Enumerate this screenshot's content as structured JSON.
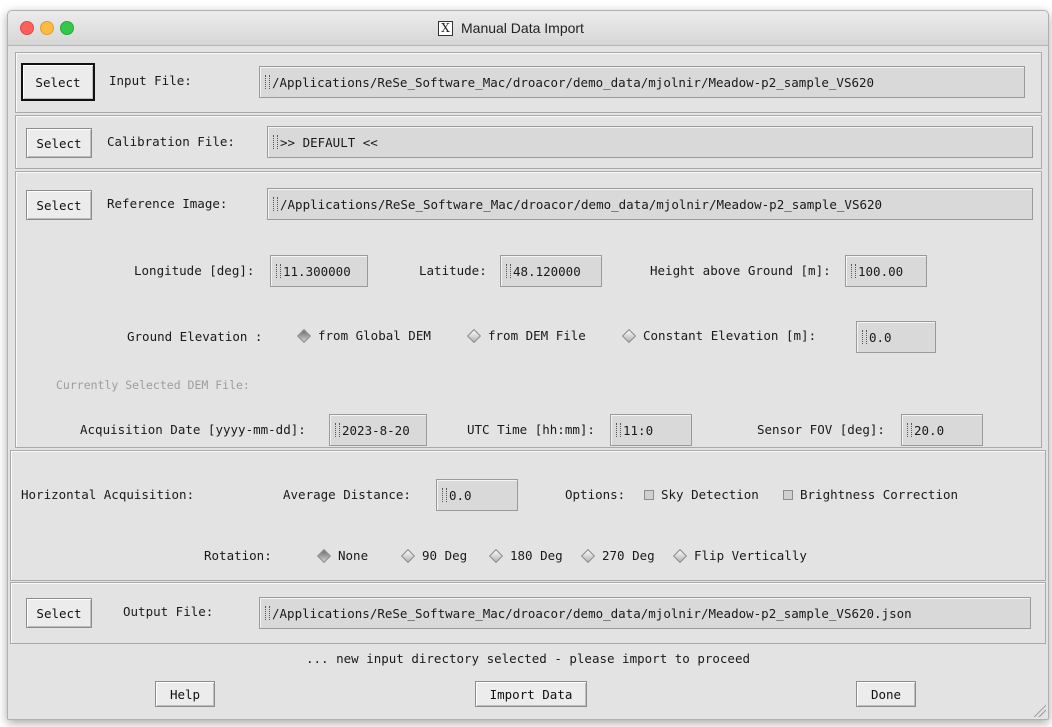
{
  "window": {
    "title": "Manual Data Import"
  },
  "files": {
    "select_label": "Select",
    "input": {
      "label": "Input File:",
      "value": "/Applications/ReSe_Software_Mac/droacor/demo_data/mjolnir/Meadow-p2_sample_VS620"
    },
    "calibration": {
      "label": "Calibration File:",
      "value": ">> DEFAULT <<"
    },
    "reference": {
      "label": "Reference Image:",
      "value": "/Applications/ReSe_Software_Mac/droacor/demo_data/mjolnir/Meadow-p2_sample_VS620"
    }
  },
  "position": {
    "longitude": {
      "label": "Longitude [deg]:",
      "value": "11.300000"
    },
    "latitude": {
      "label": "Latitude:",
      "value": "48.120000"
    },
    "height": {
      "label": "Height above Ground [m]:",
      "value": "100.00"
    }
  },
  "elevation": {
    "label": "Ground Elevation :",
    "options": [
      "from Global DEM",
      "from DEM File",
      "Constant Elevation [m]:"
    ],
    "selected": "from Global DEM",
    "constant_value": "0.0",
    "dem_file_label": "Currently Selected DEM File:"
  },
  "acquisition": {
    "date": {
      "label": "Acquisition Date [yyyy-mm-dd]:",
      "value": "2023-8-20"
    },
    "time": {
      "label": "UTC Time [hh:mm]:",
      "value": "11:0"
    },
    "fov": {
      "label": "Sensor FOV [deg]:",
      "value": "20.0"
    }
  },
  "horizontal": {
    "label": "Horizontal Acquisition:",
    "distance": {
      "label": "Average Distance:",
      "value": "0.0"
    },
    "options_label": "Options:",
    "options": [
      "Sky Detection",
      "Brightness Correction"
    ],
    "rotation_label": "Rotation:",
    "rotation_options": [
      "None",
      "90 Deg",
      "180 Deg",
      "270 Deg",
      "Flip Vertically"
    ],
    "rotation_selected": "None"
  },
  "output": {
    "label": "Output File:",
    "value": "/Applications/ReSe_Software_Mac/droacor/demo_data/mjolnir/Meadow-p2_sample_VS620.json"
  },
  "status": "... new input directory selected - please import to proceed",
  "buttons": {
    "help": "Help",
    "import": "Import Data",
    "done": "Done"
  },
  "colors": {
    "close": "#fc605c",
    "minimize": "#fdbc40",
    "zoom": "#34c84a",
    "window_bg": "#e3e3e3",
    "field_bg": "#d9d9d9"
  }
}
